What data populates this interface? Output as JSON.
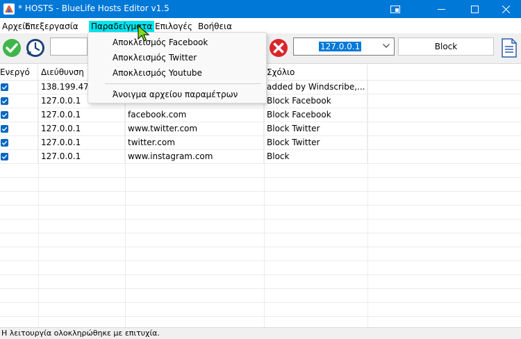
{
  "window": {
    "title": "* HOSTS - BlueLife Hosts Editor v1.5"
  },
  "menubar": {
    "items": [
      "Αρχείο",
      "Επεξεργασία",
      "Παραδείγματα",
      "Επιλογές",
      "Βοήθεια"
    ],
    "active_index": 2
  },
  "dropdown": {
    "items": [
      "Αποκλεισμός Facebook",
      "Αποκλεισμός Twitter",
      "Αποκλεισμός Youtube"
    ],
    "footer_item": "Άνοιγμα αρχείου παραμέτρων"
  },
  "toolbar": {
    "ip_value": "127.0.0.1",
    "block_label": "Block"
  },
  "table": {
    "headers": [
      "Ενεργό",
      "Διεύθυνση",
      "",
      "Σχόλιο"
    ],
    "rows": [
      {
        "ip": "138.199.47",
        "host": "",
        "comment": "added by Windscribe,..."
      },
      {
        "ip": "127.0.0.1",
        "host": "www.facebook.com",
        "comment": "Block Facebook"
      },
      {
        "ip": "127.0.0.1",
        "host": "facebook.com",
        "comment": "Block Facebook"
      },
      {
        "ip": "127.0.0.1",
        "host": "www.twitter.com",
        "comment": "Block Twitter"
      },
      {
        "ip": "127.0.0.1",
        "host": "twitter.com",
        "comment": "Block Twitter"
      },
      {
        "ip": "127.0.0.1",
        "host": "www.instagram.com",
        "comment": "Block"
      }
    ]
  },
  "status": {
    "text": "Η λειτουργία ολοκληρώθηκε με επιτυχία."
  },
  "colors": {
    "titlebar": "#0078d7",
    "menu_highlight": "#00e5ee",
    "checkbox": "#0067c0",
    "selection": "#0078d7"
  },
  "icons": {
    "app": "hosts-editor-logo-icon",
    "save": "green-check-icon",
    "schedule": "clock-icon",
    "delete": "red-x-icon",
    "notes": "document-icon"
  }
}
